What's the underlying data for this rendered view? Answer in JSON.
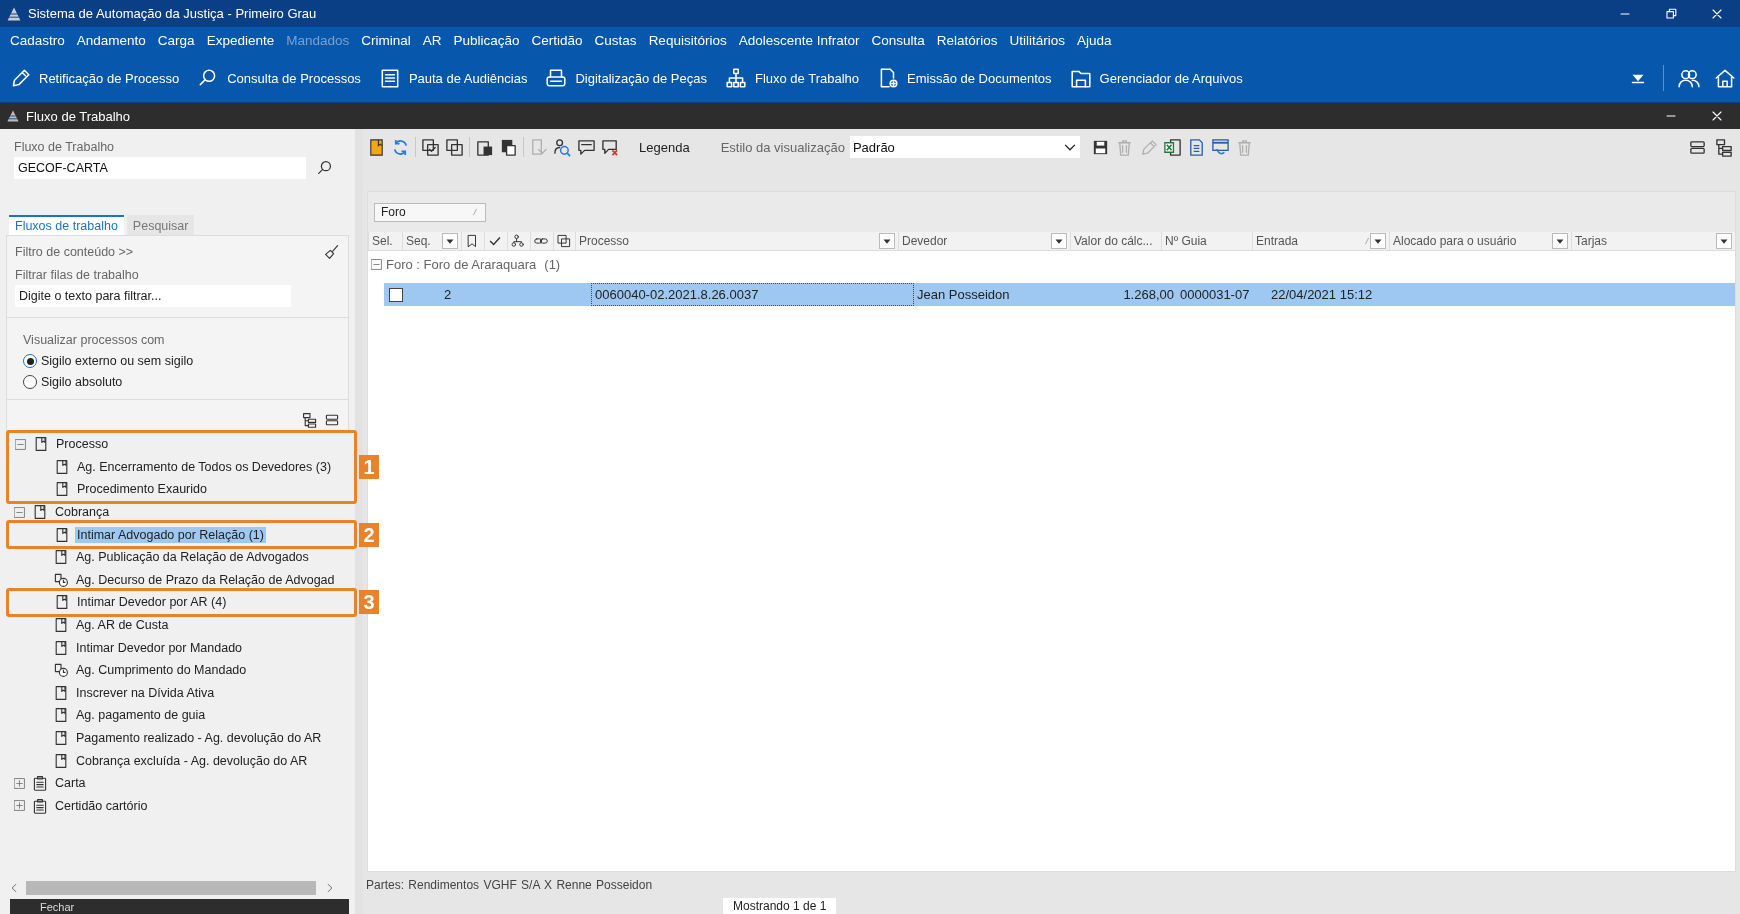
{
  "app": {
    "title": "Sistema de Automação da Justiça - Primeiro Grau"
  },
  "menu": [
    {
      "label": "Cadastro",
      "disabled": false
    },
    {
      "label": "Andamento",
      "disabled": false
    },
    {
      "label": "Carga",
      "disabled": false
    },
    {
      "label": "Expediente",
      "disabled": false
    },
    {
      "label": "Mandados",
      "disabled": true
    },
    {
      "label": "Criminal",
      "disabled": false
    },
    {
      "label": "AR",
      "disabled": false
    },
    {
      "label": "Publicação",
      "disabled": false
    },
    {
      "label": "Certidão",
      "disabled": false
    },
    {
      "label": "Custas",
      "disabled": false
    },
    {
      "label": "Requisitórios",
      "disabled": false
    },
    {
      "label": "Adolescente Infrator",
      "disabled": false
    },
    {
      "label": "Consulta",
      "disabled": false
    },
    {
      "label": "Relatórios",
      "disabled": false
    },
    {
      "label": "Utilitários",
      "disabled": false
    },
    {
      "label": "Ajuda",
      "disabled": false
    }
  ],
  "shortcuts": [
    "Retificação de Processo",
    "Consulta de Processos",
    "Pauta de Audiências",
    "Digitalização de Peças",
    "Fluxo de Trabalho",
    "Emissão de Documentos",
    "Gerenciador de Arquivos"
  ],
  "window": {
    "title": "Fluxo de Trabalho"
  },
  "left": {
    "workflow_label": "Fluxo de Trabalho",
    "workflow_value": "GECOF-CARTA",
    "tabs": [
      {
        "label": "Fluxos de trabalho",
        "selected": true
      },
      {
        "label": "Pesquisar",
        "selected": false
      }
    ],
    "content_filter": "Filtro de conteúdo >>",
    "filter_label": "Filtrar filas de trabalho",
    "filter_placeholder": "Digite o texto para filtrar...",
    "visibility": {
      "label": "Visualizar processos com",
      "options": [
        {
          "label": "Sigilo externo ou sem sigilo",
          "selected": true
        },
        {
          "label": "Sigilo absoluto",
          "selected": false
        }
      ]
    },
    "tree": [
      {
        "label": "Processo",
        "kind": "queue",
        "expanded": true,
        "selected": false,
        "callout": "1",
        "children": [
          {
            "label": "Ag. Encerramento de Todos os Devedores (3)",
            "kind": "queue",
            "selected": false
          },
          {
            "label": "Procedimento Exaurido",
            "kind": "queue",
            "selected": false
          }
        ]
      },
      {
        "label": "Cobrança",
        "kind": "queue",
        "expanded": true,
        "selected": false,
        "children": [
          {
            "label": "Intimar Advogado por Relação (1)",
            "kind": "queue",
            "selected": true,
            "callout": "2"
          },
          {
            "label": "Ag. Publicação da Relação de Advogados",
            "kind": "queue",
            "selected": false
          },
          {
            "label": "Ag. Decurso de Prazo da Relação de Advogad",
            "kind": "timed",
            "selected": false
          },
          {
            "label": "Intimar Devedor por AR (4)",
            "kind": "queue",
            "selected": false,
            "callout": "3"
          },
          {
            "label": "Ag. AR de Custa",
            "kind": "queue",
            "selected": false
          },
          {
            "label": "Intimar Devedor por Mandado",
            "kind": "queue",
            "selected": false
          },
          {
            "label": "Ag. Cumprimento do Mandado",
            "kind": "timed",
            "selected": false
          },
          {
            "label": "Inscrever na Dívida Ativa",
            "kind": "queue",
            "selected": false
          },
          {
            "label": "Ag. pagamento de guia",
            "kind": "queue",
            "selected": false
          },
          {
            "label": "Pagamento realizado - Ag. devolução do AR",
            "kind": "queue",
            "selected": false
          },
          {
            "label": "Cobrança excluída - Ag. devolução do AR",
            "kind": "queue",
            "selected": false
          }
        ]
      },
      {
        "label": "Carta",
        "kind": "category",
        "expanded": false,
        "selected": false
      },
      {
        "label": "Certidão cartório",
        "kind": "category",
        "expanded": false,
        "selected": false
      }
    ],
    "close_button": "Fechar"
  },
  "right": {
    "tools_left": [
      {
        "disabled": false
      },
      {
        "disabled": false
      },
      {
        "disabled": false
      },
      {
        "disabled": false
      },
      {
        "disabled": false
      },
      {
        "disabled": false
      },
      {
        "disabled": true
      },
      {
        "disabled": false
      },
      {
        "disabled": false
      },
      {
        "disabled": false
      }
    ],
    "legend_button": "Legenda",
    "style_label": "Estilo da visualização",
    "style_value": "Padrão",
    "tools_right": [
      {
        "disabled": false
      },
      {
        "disabled": true
      },
      {
        "disabled": true
      },
      {
        "disabled": false
      },
      {
        "disabled": false
      },
      {
        "disabled": false
      },
      {
        "disabled": true
      }
    ],
    "group_by": [
      {
        "label": "Foro",
        "sorted": true
      }
    ],
    "columns": [
      {
        "label": "Sel.",
        "filter": false,
        "sorted": false
      },
      {
        "label": "Seq.",
        "filter": true,
        "sorted": false
      },
      {
        "filter": false,
        "sorted": false
      },
      {
        "filter": false,
        "sorted": false
      },
      {
        "filter": false,
        "sorted": false
      },
      {
        "filter": false,
        "sorted": false
      },
      {
        "filter": false,
        "sorted": false
      },
      {
        "label": "Processo",
        "filter": true,
        "sorted": false
      },
      {
        "label": "Devedor",
        "filter": true,
        "sorted": false
      },
      {
        "label": "Valor do cálc...",
        "filter": false,
        "sorted": false
      },
      {
        "label": "Nº Guia",
        "filter": false,
        "sorted": false
      },
      {
        "label": "Entrada",
        "filter": true,
        "sorted": true
      },
      {
        "label": "Alocado para o usuário",
        "filter": true,
        "sorted": false
      },
      {
        "label": "Tarjas",
        "filter": true,
        "sorted": false
      }
    ],
    "group": {
      "label": "Foro : Foro de Araraquara",
      "count": "(1)",
      "expanded": true
    },
    "rows": [
      {
        "selected": true,
        "checked": false,
        "seq": "2",
        "processo": "0060040-02.2021.8.26.0037",
        "devedor": "Jean Posseidon",
        "valor": "1.268,00",
        "guia": "0000031-07",
        "entrada": "22/04/2021 15:12"
      }
    ],
    "parties": "Partes: Rendimentos VGHF S/A  X  Renne Posseidon",
    "pager": "Mostrando 1 de 1"
  }
}
